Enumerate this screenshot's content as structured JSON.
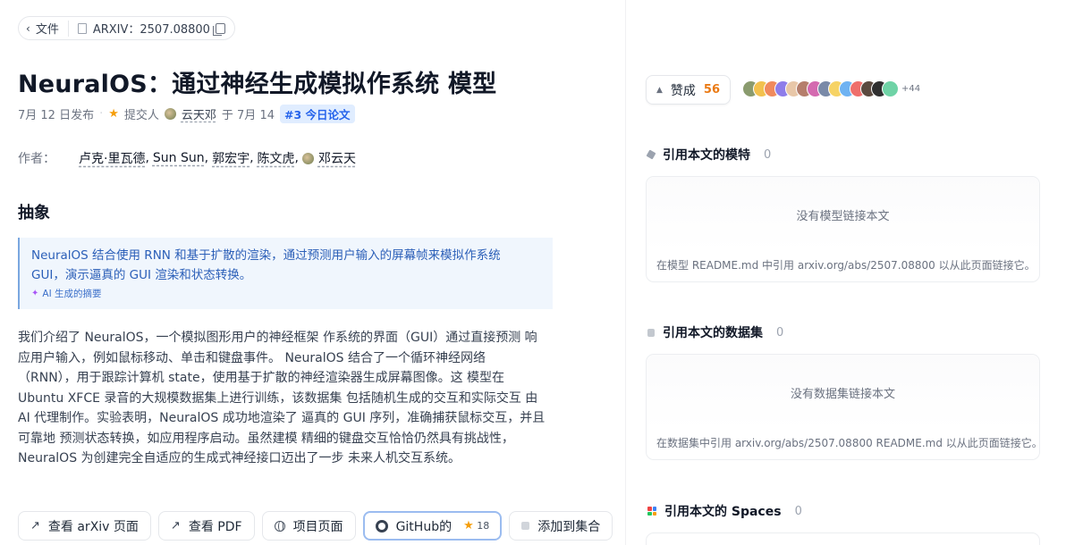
{
  "breadcrumb": {
    "back_label": "文件",
    "doc_id": "ARXIV：2507.08800"
  },
  "paper": {
    "title": "NeuralOS：通过神经生成模拟作系统 模型",
    "published": "7月 12 日发布",
    "submitted_by_label": "提交人",
    "submitter": "云天邓",
    "submitted_on": "于 7月 14",
    "daily_badge": "#3 今日论文",
    "authors_label": "作者：",
    "authors": [
      "卢克·里瓦德",
      "Sun Sun",
      "郭宏宇",
      "陈文虎",
      "邓云天"
    ],
    "abstract_heading": "抽象",
    "ai_summary": "NeuralOS 结合使用 RNN 和基于扩散的渲染，通过预测用户输入的屏幕帧来模拟作系统 GUI，演示逼真的 GUI 渲染和状态转换。",
    "ai_summary_note": "AI 生成的摘要",
    "abstract_lines": [
      "我们介绍了 NeuralOS，一个模拟图形用户的神经框架 作系统的界面（GUI）通过直接预测 响",
      "应用户输入，例如鼠标移动、单击和键盘事件。 NeuralOS 结合了一个循环神经网络",
      "（RNN），用于跟踪计算机 state，使用基于扩散的神经渲染器生成屏幕图像。这 模型在",
      "Ubuntu XFCE 录音的大规模数据集上进行训练，该数据集 包括随机生成的交互和实际交互 由",
      "AI 代理制作。实验表明，NeuralOS 成功地渲染了 逼真的 GUI 序列，准确捕获鼠标交互，并且",
      "可靠地 预测状态转换，如应用程序启动。虽然建模 精细的键盘交互恰恰仍然具有挑战性，",
      "NeuralOS 为创建完全自适应的生成式神经接口迈出了一步 未来人机交互系统。"
    ]
  },
  "actions": {
    "arxiv": "查看 arXiv 页面",
    "pdf": "查看 PDF",
    "project": "项目页面",
    "github": "GitHub的",
    "github_stars": "18",
    "collection": "添加到集合"
  },
  "sidebar": {
    "upvote_label": "赞成",
    "upvote_count": "56",
    "more_upvoters": "+44",
    "models": {
      "title": "引用本文的模特",
      "count": "0",
      "empty": "没有模型链接本文",
      "hint": "在模型 README.md 中引用 arxiv.org/abs/2507.08800 以从此页面链接它。"
    },
    "datasets": {
      "title": "引用本文的数据集",
      "count": "0",
      "empty": "没有数据集链接本文",
      "hint": "在数据集中引用 arxiv.org/abs/2507.08800 README.md 以从此页面链接它。"
    },
    "spaces": {
      "title": "引用本文的 Spaces",
      "count": "0"
    }
  },
  "colors": {
    "accent": "#2563eb",
    "upvote": "#ea7a14",
    "star": "#f59e0b",
    "ai_box_bg": "#f0f6fd"
  }
}
